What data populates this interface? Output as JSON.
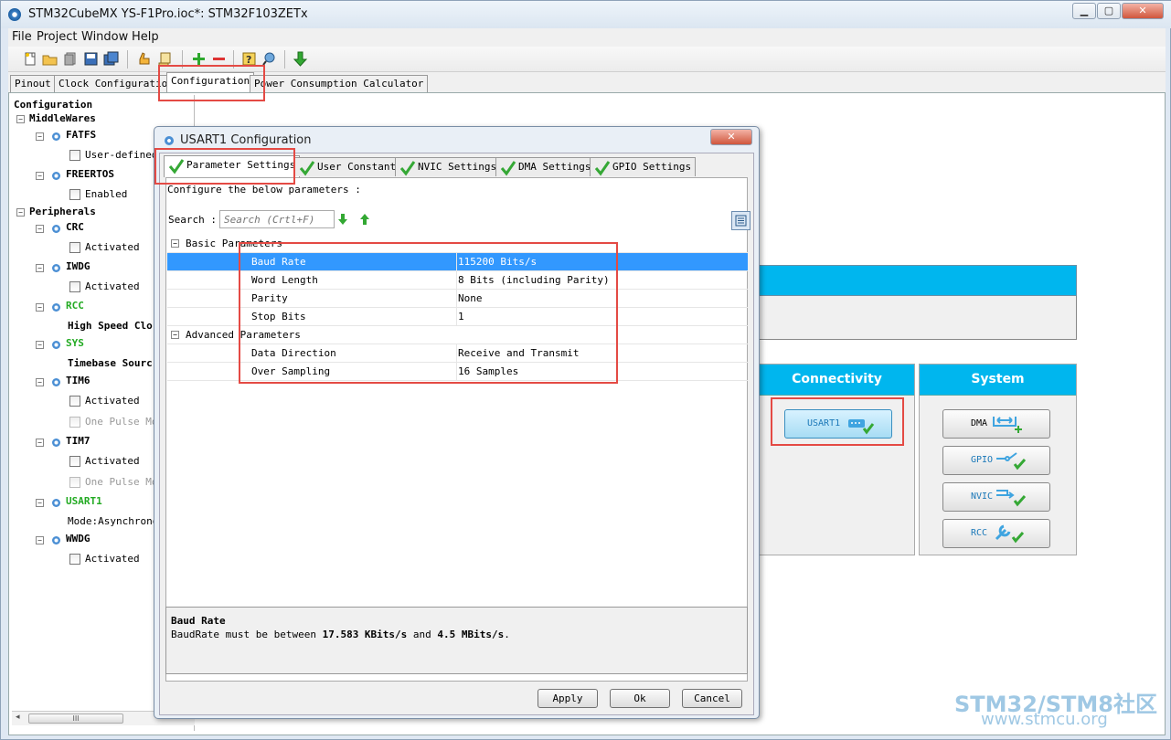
{
  "window": {
    "title": "STM32CubeMX YS-F1Pro.ioc*: STM32F103ZETx",
    "min_label": "▁",
    "max_label": "▢",
    "close_label": "✕"
  },
  "menu": [
    "File",
    "Project",
    "Window",
    "Help"
  ],
  "main_tabs": [
    "Pinout",
    "Clock Configuration",
    "Configuration",
    "Power Consumption Calculator"
  ],
  "main_tabs_active": "Configuration",
  "tree": {
    "root": "Configuration",
    "middlewares": "MiddleWares",
    "fatfs": "FATFS",
    "fatfs_opt": "User-defined",
    "freertos": "FREERTOS",
    "freertos_opt": "Enabled",
    "peripherals": "Peripherals",
    "crc": "CRC",
    "crc_opt": "Activated",
    "iwdg": "IWDG",
    "iwdg_opt": "Activated",
    "rcc": "RCC",
    "rcc_opt": "High Speed Clo",
    "sys": "SYS",
    "sys_opt": "Timebase Sourc",
    "tim6": "TIM6",
    "tim6_opt1": "Activated",
    "tim6_opt2": "One Pulse Mod",
    "tim7": "TIM7",
    "tim7_opt1": "Activated",
    "tim7_opt2": "One Pulse Mod",
    "usart1": "USART1",
    "usart1_opt": "Mode:Asynchrono",
    "wwdg": "WWDG",
    "wwdg_opt": "Activated"
  },
  "scroll_thumb": "III",
  "categories": {
    "connectivity": "Connectivity",
    "system": "System",
    "usart1_btn": "USART1",
    "dma_btn": "DMA",
    "gpio_btn": "GPIO",
    "nvic_btn": "NVIC",
    "rcc_btn": "RCC"
  },
  "dialog": {
    "title": "USART1 Configuration",
    "close_label": "✕",
    "tabs": [
      "Parameter Settings",
      "User Constants",
      "NVIC Settings",
      "DMA Settings",
      "GPIO Settings"
    ],
    "instruction": "Configure the below parameters :",
    "search_label": "Search :",
    "search_placeholder": "Search (Crtl+F)",
    "groups": {
      "basic": "Basic Parameters",
      "advanced": "Advanced Parameters"
    },
    "params": [
      {
        "name": "Baud Rate",
        "value": "115200 Bits/s"
      },
      {
        "name": "Word Length",
        "value": "8 Bits (including Parity)"
      },
      {
        "name": "Parity",
        "value": "None"
      },
      {
        "name": "Stop Bits",
        "value": "1"
      },
      {
        "name": "Data Direction",
        "value": "Receive and Transmit"
      },
      {
        "name": "Over Sampling",
        "value": "16 Samples"
      }
    ],
    "desc_title": "Baud Rate",
    "desc_pre": "BaudRate must be between ",
    "desc_min": "17.583 KBits/s",
    "desc_mid": " and ",
    "desc_max": "4.5 MBits/s",
    "desc_end": ".",
    "buttons": {
      "apply": "Apply",
      "ok": "Ok",
      "cancel": "Cancel"
    }
  },
  "watermark": {
    "brand": "STM32/STM8社区",
    "url": "www.stmcu.org"
  },
  "colors": {
    "accent_blue": "#00b6ee",
    "selection": "#3298fe",
    "highlight_box": "#e44a44",
    "active_green": "#22aa22"
  }
}
